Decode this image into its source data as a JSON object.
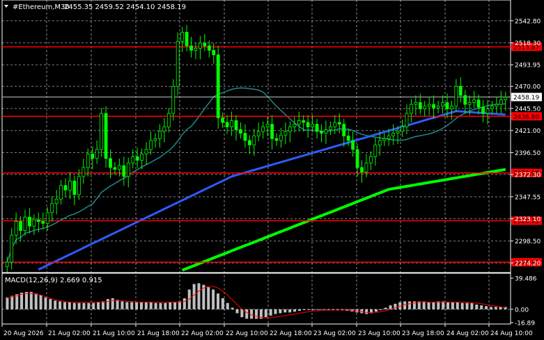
{
  "header": {
    "symbol": "#Ethereum,M30",
    "ohlc": "2455.35 2459.52 2454.10 2458.19"
  },
  "macd_header": "MACD(12,26,9) 2.669 0.915",
  "price_axis": {
    "ticks": [
      "2542.80",
      "2518.30",
      "2493.95",
      "2470.00",
      "2445.50",
      "2421.00",
      "2396.50",
      "2372.30",
      "2347.55",
      "2323.10",
      "2298.50",
      "2274.20"
    ],
    "current_price": "2458.19"
  },
  "macd_axis": {
    "ticks": [
      "39.486",
      "0.00",
      "-16.89"
    ]
  },
  "time_axis": {
    "labels": [
      "20 Aug 2026",
      "21 Aug 02:00",
      "21 Aug 10:00",
      "21 Aug 18:00",
      "22 Aug 02:00",
      "22 Aug 10:00",
      "22 Aug 18:00",
      "23 Aug 02:00",
      "23 Aug 10:00",
      "23 Aug 18:00",
      "24 Aug 02:00",
      "24 Aug 10:00"
    ]
  },
  "levels": [
    {
      "label": "2513.87",
      "value": 2513.87
    },
    {
      "label": "2436.80",
      "value": 2436.8
    },
    {
      "label": "2373.98",
      "value": 2373.98
    },
    {
      "label": "2320.93",
      "value": 2320.93
    },
    {
      "label": "2274.91",
      "value": 2274.91
    }
  ],
  "colors": {
    "background": "#000000",
    "candles": "#00ff00",
    "level_lines": "#ff0000",
    "level_label_bg": "#ff0000",
    "ma_slow": "#00ff00",
    "ma_mid": "#2e5bff",
    "ma_fast": "#1f8a8a",
    "macd_hist": "#c0c0c0",
    "macd_signal": "#ff0000",
    "current_price_line": "#c0c0c0",
    "grid": "#ffffff"
  },
  "chart_data": {
    "type": "candlestick",
    "symbol": "#Ethereum",
    "timeframe": "M30",
    "price_range": [
      2265,
      2555
    ],
    "grid": "dashed",
    "closes": [
      2275,
      2305,
      2320,
      2310,
      2325,
      2315,
      2322,
      2320,
      2318,
      2330,
      2340,
      2345,
      2360,
      2355,
      2365,
      2350,
      2370,
      2380,
      2395,
      2390,
      2400,
      2440,
      2390,
      2380,
      2378,
      2382,
      2370,
      2385,
      2392,
      2388,
      2395,
      2400,
      2410,
      2412,
      2420,
      2425,
      2440,
      2470,
      2520,
      2530,
      2515,
      2510,
      2512,
      2518,
      2515,
      2510,
      2505,
      2435,
      2430,
      2425,
      2432,
      2422,
      2418,
      2410,
      2405,
      2415,
      2420,
      2425,
      2428,
      2412,
      2410,
      2416,
      2420,
      2425,
      2428,
      2432,
      2430,
      2425,
      2428,
      2420,
      2418,
      2422,
      2425,
      2430,
      2428,
      2415,
      2410,
      2400,
      2380,
      2375,
      2385,
      2392,
      2405,
      2410,
      2412,
      2415,
      2418,
      2420,
      2425,
      2440,
      2450,
      2452,
      2445,
      2448,
      2450,
      2446,
      2448,
      2452,
      2445,
      2448,
      2470,
      2460,
      2450,
      2452,
      2455,
      2447,
      2440,
      2445,
      2448,
      2450,
      2455,
      2458
    ],
    "level_lines": [
      2513.87,
      2436.8,
      2373.98,
      2320.93,
      2274.91
    ],
    "macd": {
      "label": "MACD(12,26,9) 2.669 0.915",
      "hist": [
        15,
        17,
        19,
        21,
        22,
        22,
        20,
        18,
        15,
        13,
        11,
        10,
        9,
        9,
        8,
        8,
        8,
        8,
        8,
        9,
        10,
        13,
        14,
        12,
        10,
        9,
        9,
        9,
        9,
        9,
        9,
        8,
        8,
        8,
        9,
        9,
        10,
        14,
        25,
        32,
        33,
        31,
        28,
        25,
        20,
        14,
        8,
        2,
        -5,
        -10,
        -12,
        -12,
        -12,
        -12,
        -10,
        -8,
        -6,
        -5,
        -4,
        -4,
        -3,
        -2,
        -1,
        0,
        0,
        0,
        0,
        0,
        -1,
        -1,
        -1,
        -2,
        -3,
        -4,
        -5,
        -6,
        -5,
        -3,
        -1,
        2,
        5,
        7,
        9,
        10,
        10,
        10,
        10,
        10,
        9,
        9,
        10,
        10,
        9,
        9,
        9,
        8,
        8,
        8,
        6,
        5,
        4,
        3,
        3,
        3,
        3
      ],
      "signal": [
        14,
        16,
        17,
        19,
        20,
        20,
        19,
        18,
        16,
        14,
        12,
        11,
        10,
        9,
        9,
        9,
        9,
        9,
        9,
        9,
        9,
        10,
        11,
        11,
        11,
        10,
        10,
        9,
        9,
        9,
        9,
        9,
        9,
        9,
        9,
        9,
        9,
        10,
        13,
        18,
        23,
        27,
        29,
        29,
        27,
        23,
        18,
        12,
        6,
        0,
        -4,
        -7,
        -9,
        -10,
        -11,
        -11,
        -10,
        -9,
        -8,
        -7,
        -6,
        -5,
        -4,
        -3,
        -2,
        -2,
        -1,
        -1,
        -1,
        -1,
        -1,
        -1,
        -2,
        -2,
        -3,
        -4,
        -4,
        -4,
        -3,
        -2,
        0,
        2,
        4,
        6,
        7,
        8,
        9,
        9,
        9,
        9,
        9,
        9,
        9,
        9,
        9,
        9,
        9,
        8,
        8,
        7,
        6,
        5,
        4,
        3,
        2
      ],
      "range": [
        -16.89,
        39.486
      ]
    }
  }
}
